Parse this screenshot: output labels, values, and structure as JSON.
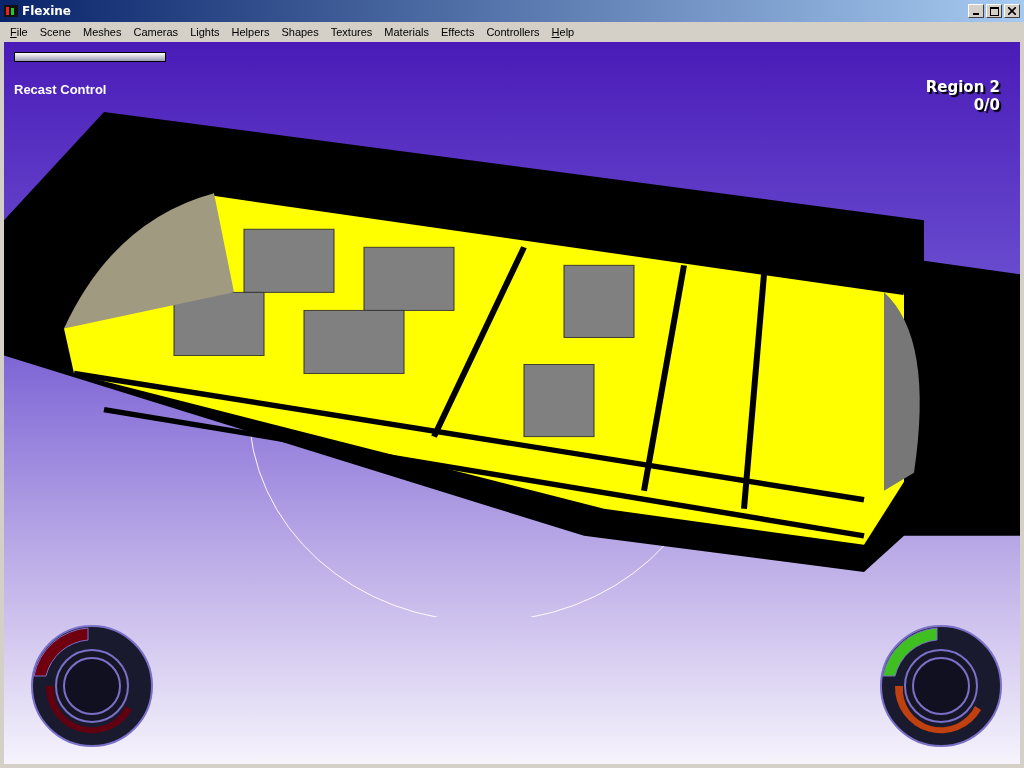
{
  "window": {
    "title": "Flexine"
  },
  "menu": [
    {
      "label": "File",
      "mnemonic": true
    },
    {
      "label": "Scene",
      "mnemonic": false
    },
    {
      "label": "Meshes",
      "mnemonic": false
    },
    {
      "label": "Cameras",
      "mnemonic": false
    },
    {
      "label": "Lights",
      "mnemonic": false
    },
    {
      "label": "Helpers",
      "mnemonic": false
    },
    {
      "label": "Shapes",
      "mnemonic": false
    },
    {
      "label": "Textures",
      "mnemonic": false
    },
    {
      "label": "Materials",
      "mnemonic": false
    },
    {
      "label": "Effects",
      "mnemonic": false
    },
    {
      "label": "Controllers",
      "mnemonic": false
    },
    {
      "label": "Help",
      "mnemonic": true
    }
  ],
  "viewport": {
    "progress": {
      "level": 1
    },
    "panel_title": "Recast Control",
    "region": "Region 2",
    "count": "0/0"
  }
}
